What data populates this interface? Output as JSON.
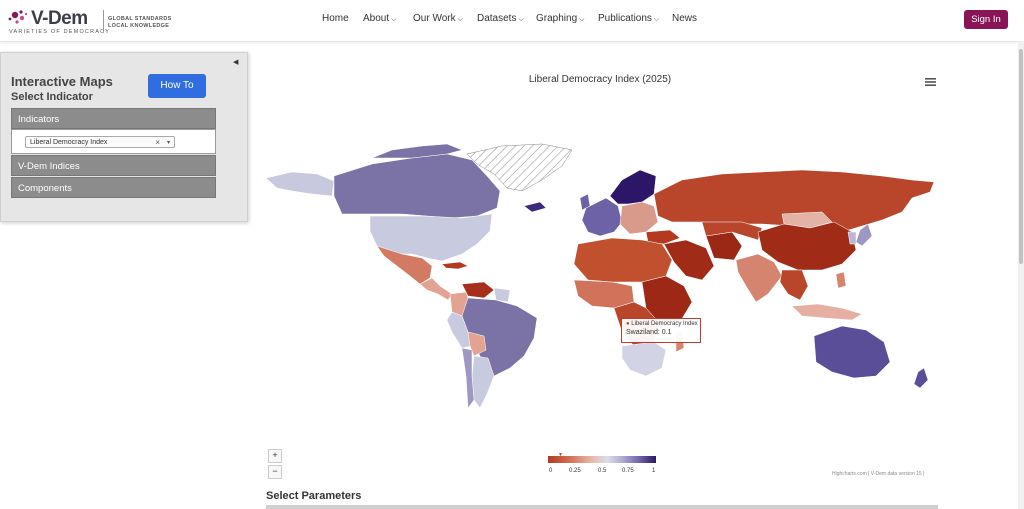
{
  "header": {
    "logo_text": "V-Dem",
    "logo_sub": "VARIETIES OF DEMOCRACY",
    "logo_tag1": "GLOBAL STANDARDS",
    "logo_tag2": "LOCAL KNOWLEDGE",
    "nav": {
      "home": "Home",
      "about": "About",
      "our_work": "Our Work",
      "datasets": "Datasets",
      "graphing": "Graphing",
      "publications": "Publications",
      "news": "News"
    },
    "sign_in": "Sign In"
  },
  "sidebar": {
    "collapse_glyph": "◀",
    "title": "Interactive Maps",
    "subtitle": "Select Indicator",
    "howto_label": "How To",
    "sections": {
      "indicators": "Indicators",
      "vdem_indices": "V-Dem Indices",
      "components": "Components"
    },
    "selected_indicator": "Liberal Democracy Index",
    "clear_glyph": "×",
    "caret_glyph": "▾"
  },
  "chart": {
    "title": "Liberal Democracy Index (2025)",
    "tooltip": {
      "series": "Liberal Democracy Index",
      "text": "Swaziland: 0.1"
    },
    "zoom_in": "+",
    "zoom_out": "−",
    "legend": {
      "ticks": [
        "0",
        "0.25",
        "0.5",
        "0.75",
        "1"
      ],
      "colors": [
        "#b5391f",
        "#d06f57",
        "#e8b6a8",
        "#dadde9",
        "#a9a7cf",
        "#6e62a6",
        "#2c1668"
      ],
      "marker_glyph": "▼"
    },
    "credits": "Highcharts.com | V-Dem data version 15 |"
  },
  "params": {
    "title": "Select Parameters"
  }
}
